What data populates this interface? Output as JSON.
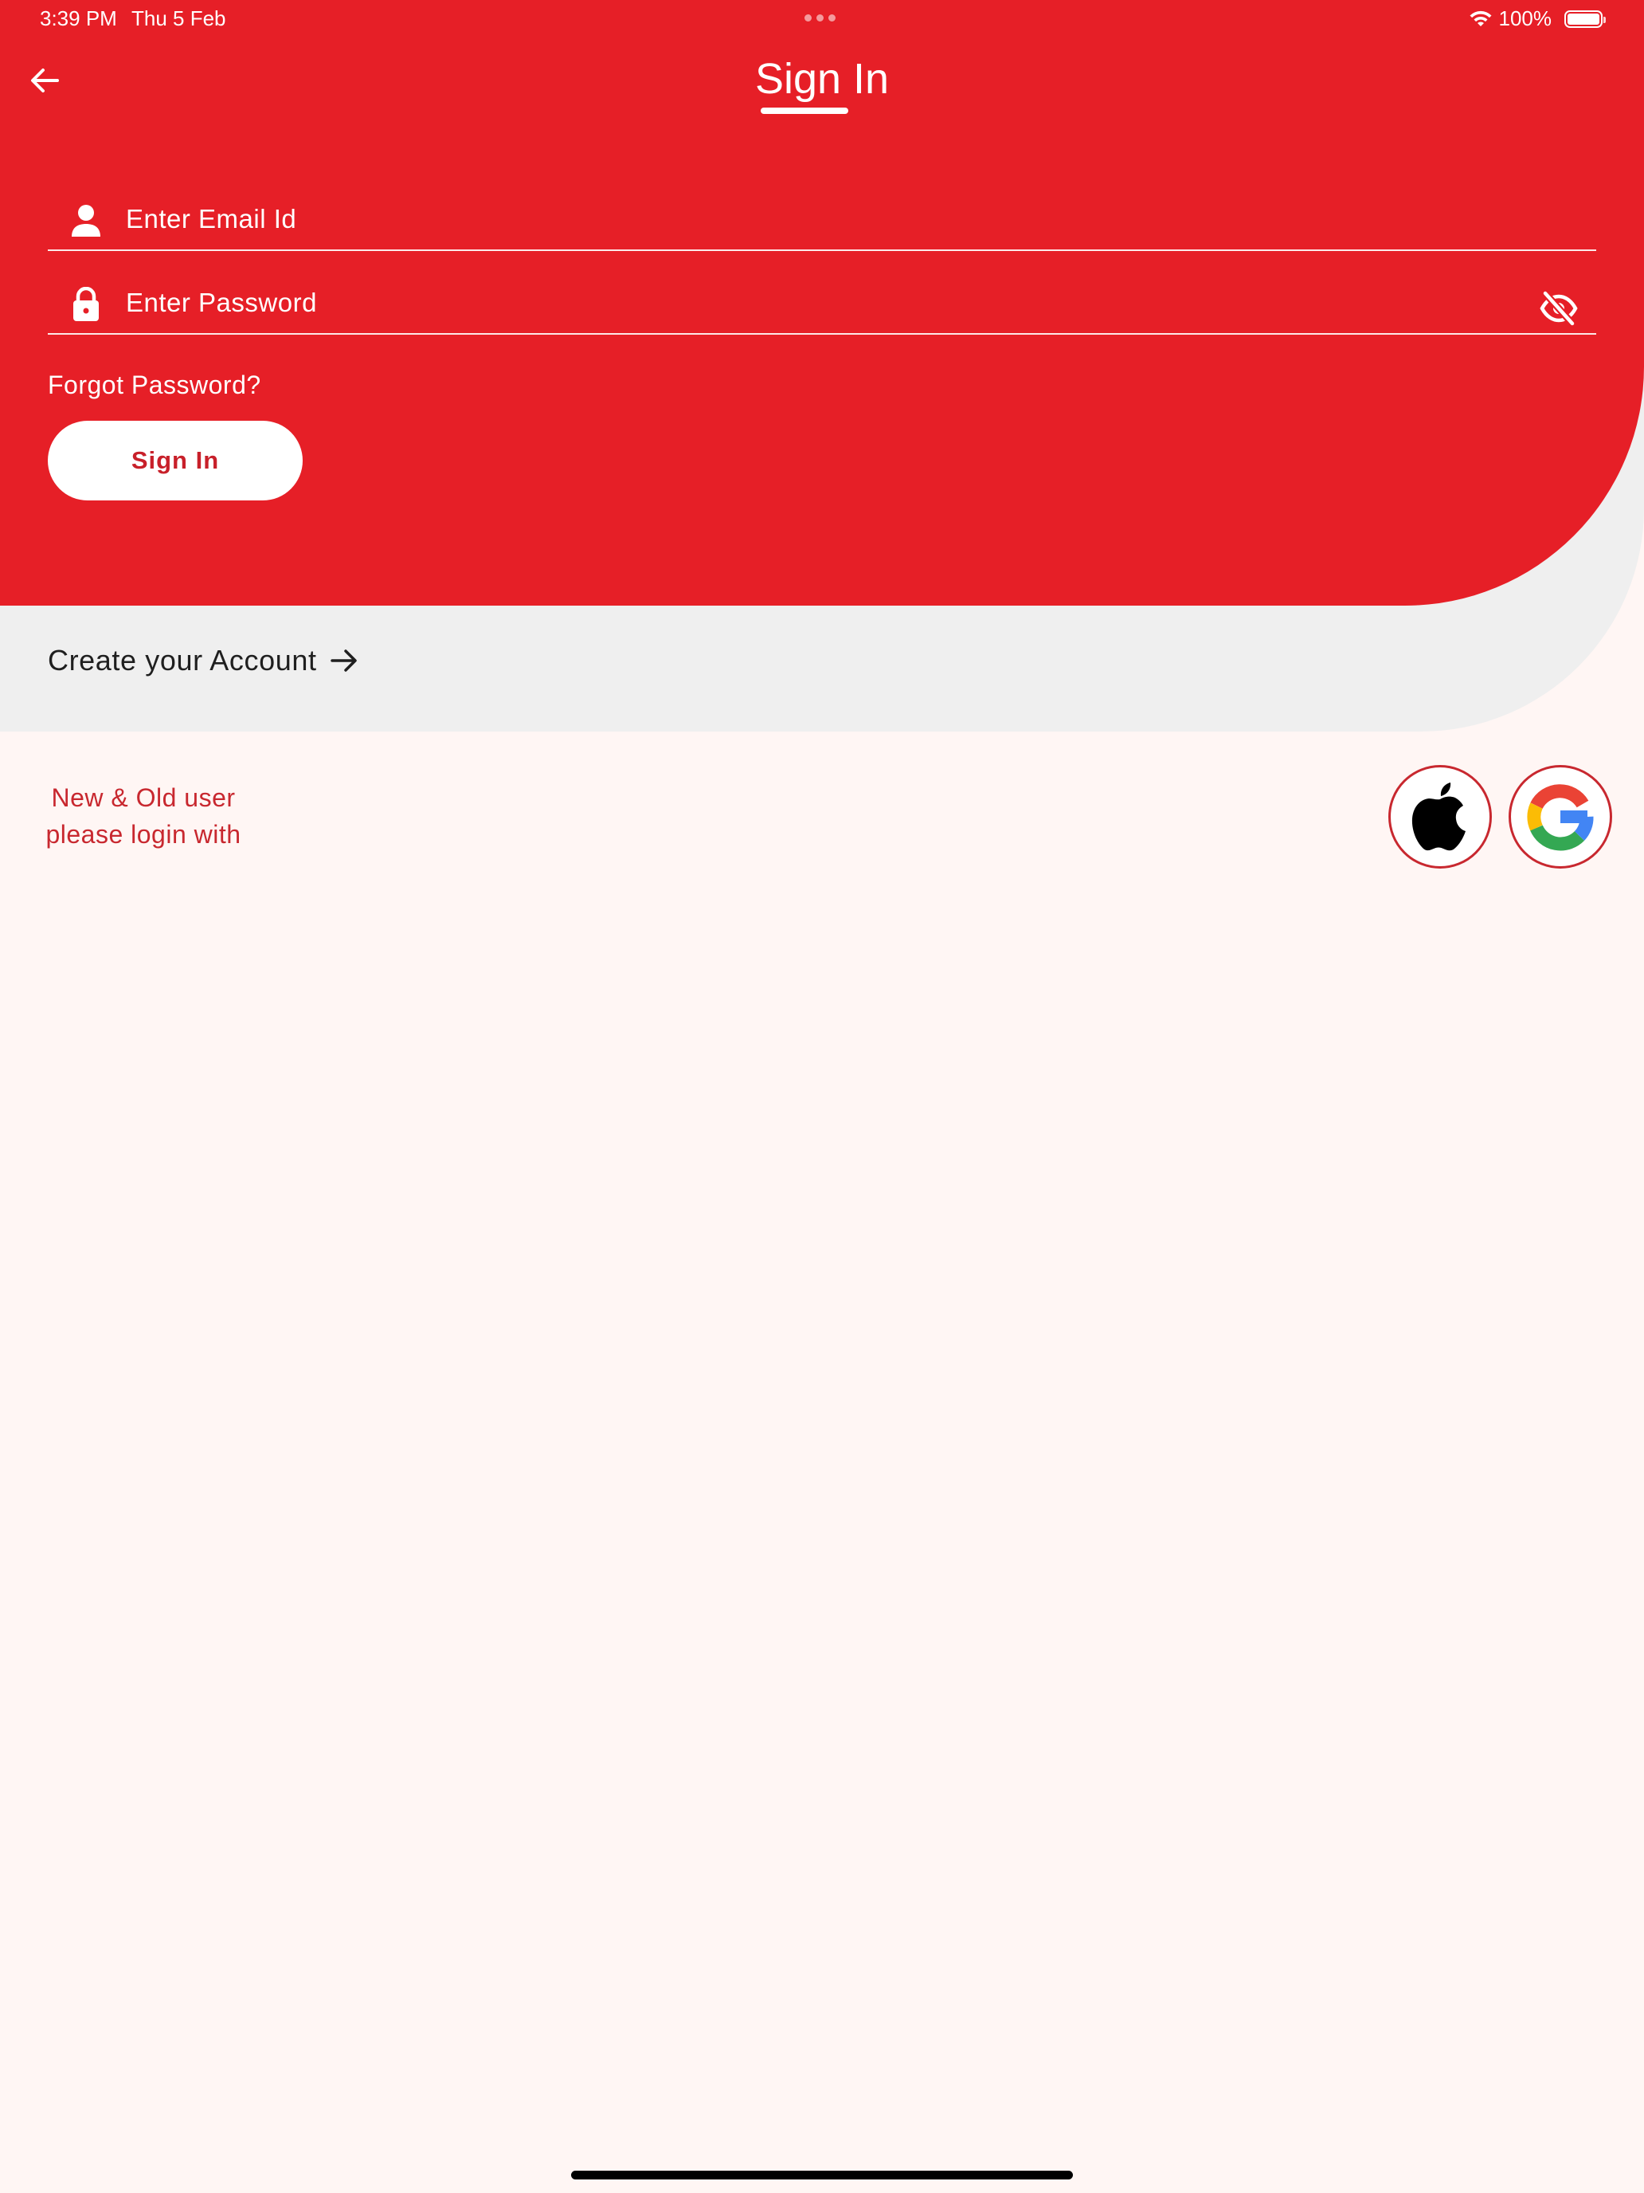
{
  "status_bar": {
    "time": "3:39 PM",
    "date": "Thu 5 Feb",
    "battery": "100%",
    "battery_level": 1.0
  },
  "header": {
    "title": "Sign In",
    "back_icon": "arrow-left-icon"
  },
  "form": {
    "email_placeholder": "Enter Email Id",
    "email_value": "",
    "email_icon": "person-icon",
    "password_placeholder": "Enter Password",
    "password_value": "",
    "password_icon": "lock-icon",
    "visibility_icon": "eye-off-icon",
    "forgot_label": "Forgot Password?",
    "submit_label": "Sign In"
  },
  "create_account": {
    "label": "Create your Account",
    "icon": "arrow-right-icon"
  },
  "social": {
    "line1": "New & Old user",
    "line2": "please login with",
    "providers": [
      "apple-logo-icon",
      "google-logo-icon"
    ]
  },
  "colors": {
    "primary_red": "#e61f27",
    "accent_red": "#c8282f",
    "gray_band": "#efefef",
    "background": "#fff6f4"
  }
}
